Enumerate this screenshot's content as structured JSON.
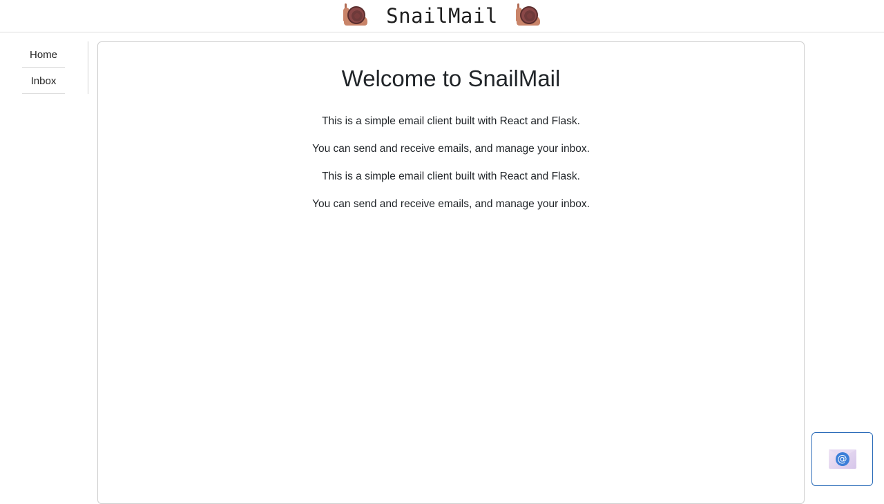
{
  "header": {
    "title": "SnailMail",
    "left_icon": "snail-icon",
    "right_icon": "snail-icon"
  },
  "nav": {
    "items": [
      {
        "label": "Home"
      },
      {
        "label": "Inbox"
      }
    ]
  },
  "main": {
    "title": "Welcome to SnailMail",
    "paragraphs": [
      "This is a simple email client built with React and Flask.",
      "You can send and receive emails, and manage your inbox.",
      "This is a simple email client built with React and Flask.",
      "You can send and receive emails, and manage your inbox."
    ]
  },
  "compose": {
    "icon": "envelope-at-icon",
    "symbol": "@",
    "accent": "#2a6bb8"
  }
}
